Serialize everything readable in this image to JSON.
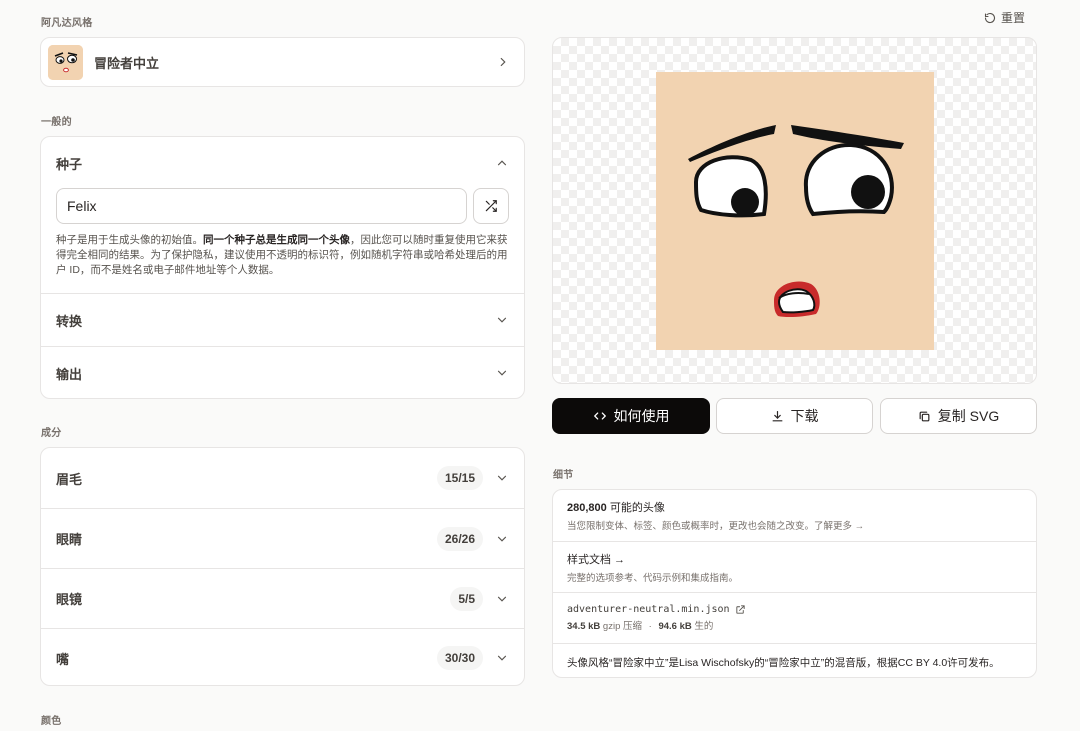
{
  "header": {
    "style_section_label": "阿凡达风格",
    "reset_label": "重置"
  },
  "style": {
    "name": "冒险者中立"
  },
  "general": {
    "section_label": "一般的",
    "seed": {
      "label": "种子",
      "value": "Felix",
      "desc_pre": "种子是用于生成头像的初始值。",
      "desc_bold": "同一个种子总是生成同一个头像",
      "desc_post": "，因此您可以随时重复使用它来获得完全相同的结果。为了保护隐私，建议使用不透明的标识符，例如随机字符串或哈希处理后的用户 ID，而不是姓名或电子邮件地址等个人数据。"
    },
    "transform_label": "转换",
    "output_label": "输出"
  },
  "components": {
    "section_label": "成分",
    "items": [
      {
        "label": "眉毛",
        "count": "15/15"
      },
      {
        "label": "眼睛",
        "count": "26/26"
      },
      {
        "label": "眼镜",
        "count": "5/5"
      },
      {
        "label": "嘴",
        "count": "30/30"
      }
    ]
  },
  "colors": {
    "section_label": "颜色"
  },
  "actions": {
    "how_to_use": "如何使用",
    "download": "下载",
    "copy_svg": "复制 SVG"
  },
  "details": {
    "section_label": "细节",
    "combos_count": "280,800",
    "combos_label": "可能的头像",
    "combos_sub": "当您限制变体、标签、颜色或概率时，更改也会随之改变。了解更多 →",
    "docs_label": "样式文档 →",
    "docs_sub": "完整的选项参考、代码示例和集成指南。",
    "file_name": "adventurer-neutral.min.json",
    "gzip_size": "34.5 kB",
    "gzip_label": "gzip 压缩",
    "separator": "·",
    "raw_size": "94.6 kB",
    "raw_label": "生的",
    "license_text": "头像风格“冒险家中立”是Lisa Wischofsky的“冒险家中立”的混音版，根据CC BY 4.0许可发布。"
  },
  "colors_palette": {
    "skin": "#f2d3b1",
    "mouth_red": "#c82b2b",
    "primary_button": "#0c0a09"
  },
  "icons": [
    "reset-icon",
    "chevron-right-icon",
    "chevron-up-icon",
    "chevron-down-icon",
    "shuffle-icon",
    "code-icon",
    "download-icon",
    "copy-icon",
    "external-link-icon"
  ]
}
